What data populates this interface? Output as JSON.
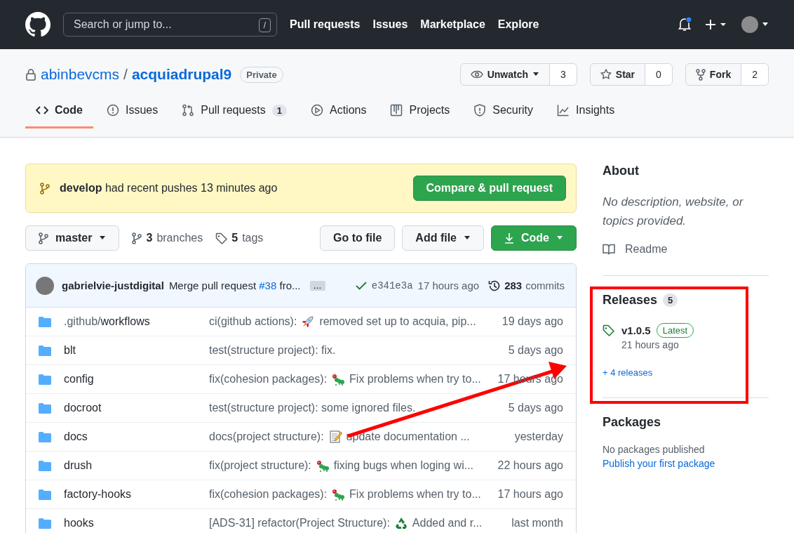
{
  "header": {
    "search_placeholder": "Search or jump to...",
    "slash_key": "/",
    "nav": [
      "Pull requests",
      "Issues",
      "Marketplace",
      "Explore"
    ],
    "notification_unread": true
  },
  "repo": {
    "owner": "abinbevcms",
    "separator": "/",
    "name": "acquiadrupal9",
    "visibility": "Private",
    "actions": [
      {
        "kind": "watch",
        "label": "Unwatch",
        "count": "3"
      },
      {
        "kind": "star",
        "label": "Star",
        "count": "0"
      },
      {
        "kind": "fork",
        "label": "Fork",
        "count": "2"
      }
    ]
  },
  "tabs": [
    {
      "kind": "code",
      "label": "Code",
      "selected": true
    },
    {
      "kind": "issues",
      "label": "Issues",
      "selected": false
    },
    {
      "kind": "pulls",
      "label": "Pull requests",
      "count": "1",
      "selected": false
    },
    {
      "kind": "actions",
      "label": "Actions",
      "selected": false
    },
    {
      "kind": "projects",
      "label": "Projects",
      "selected": false
    },
    {
      "kind": "security",
      "label": "Security",
      "selected": false
    },
    {
      "kind": "insights",
      "label": "Insights",
      "selected": false
    }
  ],
  "banner": {
    "branch": "develop",
    "text": "had recent pushes 13 minutes ago",
    "button": "Compare & pull request"
  },
  "toolbar": {
    "branch": "master",
    "branches_count": "3",
    "branches_label": "branches",
    "tags_count": "5",
    "tags_label": "tags",
    "go_to_file": "Go to file",
    "add_file": "Add file",
    "code": "Code"
  },
  "latest_commit": {
    "author": "gabrielvie-justdigital",
    "message": "Merge pull request",
    "link": "#38",
    "message_end": "fro...",
    "more": "…",
    "sha": "e341e3a",
    "time": "17 hours ago",
    "commits_count": "283",
    "commits_label": "commits"
  },
  "files": [
    {
      "dir": ".github/",
      "name": "workflows",
      "message": "ci(github actions):",
      "kind": "rocket",
      "message_rest": "removed set up to acquia, pip...",
      "time": "19 days ago"
    },
    {
      "name": "blt",
      "kind": "plain",
      "message": "test(structure project): fix.",
      "time": "5 days ago"
    },
    {
      "name": "config",
      "message": "fix(cohesion packages):",
      "kind": "bug",
      "message_rest": "Fix problems when try to...",
      "time": "17 hours ago"
    },
    {
      "name": "docroot",
      "kind": "plain",
      "message": "test(structure project): some ignored files.",
      "time": "5 days ago"
    },
    {
      "name": "docs",
      "message": "docs(project structure):",
      "kind": "memo",
      "message_rest": "update documentation ...",
      "time": "yesterday"
    },
    {
      "name": "drush",
      "message": "fix(project structure):",
      "kind": "bug",
      "message_rest": "fixing bugs when loging wi...",
      "time": "22 hours ago"
    },
    {
      "name": "factory-hooks",
      "message": "fix(cohesion packages):",
      "kind": "bug",
      "message_rest": "Fix problems when try to...",
      "time": "17 hours ago"
    },
    {
      "name": "hooks",
      "message": "[ADS-31] refactor(Project Structure):",
      "kind": "recycle",
      "message_rest": "Added and r...",
      "time": "last month"
    }
  ],
  "sidebar": {
    "about": {
      "title": "About",
      "description": "No description, website, or topics provided.",
      "readme": "Readme"
    },
    "releases": {
      "title": "Releases",
      "count": "5",
      "tag": "v1.0.5",
      "badge": "Latest",
      "time": "21 hours ago",
      "more": "+ 4 releases"
    },
    "packages": {
      "title": "Packages",
      "text": "No packages published",
      "link": "Publish your first package"
    }
  }
}
